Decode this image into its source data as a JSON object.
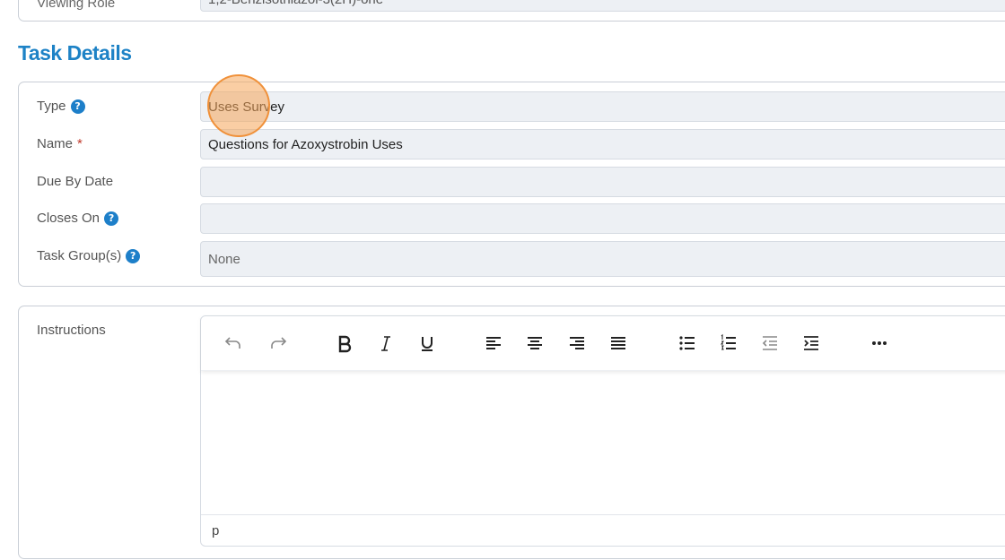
{
  "top_card": {
    "label": "Viewing Role",
    "value": "1,2-Benzisothiazol-3(2H)-one"
  },
  "section_title": "Task Details",
  "fields": {
    "type": {
      "label": "Type",
      "value": "Uses Survey"
    },
    "name": {
      "label": "Name",
      "required_mark": "*",
      "value": "Questions for Azoxystrobin Uses"
    },
    "due_by_date": {
      "label": "Due By Date",
      "value": ""
    },
    "closes_on": {
      "label": "Closes On",
      "value": ""
    },
    "task_groups": {
      "label": "Task Group(s)",
      "value": "None"
    }
  },
  "instructions": {
    "label": "Instructions",
    "toolbar": [
      "undo-icon",
      "redo-icon",
      "bold-icon",
      "italic-icon",
      "underline-icon",
      "align-left-icon",
      "align-center-icon",
      "align-right-icon",
      "align-justify-icon",
      "bullet-list-icon",
      "numbered-list-icon",
      "outdent-icon",
      "indent-icon",
      "more-icon"
    ],
    "status_path": "p"
  },
  "help_glyph": "?",
  "colors": {
    "accent": "#1d82c6",
    "help_badge": "#1d7fc9",
    "field_bg": "#edf0f4",
    "required": "#c0392b",
    "click_marker": "#f0913a"
  }
}
